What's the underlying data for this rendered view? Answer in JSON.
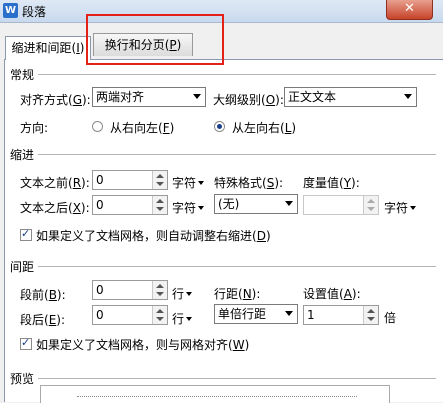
{
  "window": {
    "title": "段落",
    "icon_glyph": "W",
    "close_glyph": "✕"
  },
  "tabs": [
    {
      "label": "缩进和间距(",
      "key": "I",
      "end": ")"
    },
    {
      "label": "换行和分页(",
      "key": "P",
      "end": ")"
    }
  ],
  "general": {
    "heading": "常规",
    "align_label": "对齐方式(",
    "align_key": "G",
    "align_end": "):",
    "align_value": "两端对齐",
    "outline_label": "大纲级别(",
    "outline_key": "O",
    "outline_end": "):",
    "outline_value": "正文文本",
    "direction_label": "方向:",
    "rtl_label": "从右向左(",
    "rtl_key": "F",
    "rtl_end": ")",
    "ltr_label": "从左向右(",
    "ltr_key": "L",
    "ltr_end": ")"
  },
  "indent": {
    "heading": "缩进",
    "before_label": "文本之前(",
    "before_key": "R",
    "before_end": "):",
    "before_value": "0",
    "after_label": "文本之后(",
    "after_key": "X",
    "after_end": "):",
    "after_value": "0",
    "unit": "字符",
    "special_label": "特殊格式(",
    "special_key": "S",
    "special_end": "):",
    "special_value": "(无)",
    "measure_label": "度量值(",
    "measure_key": "Y",
    "measure_end": "):",
    "measure_value": "",
    "grid_check": "如果定义了文档网格，则自动调整右缩进(",
    "grid_key": "D",
    "grid_end": ")"
  },
  "spacing": {
    "heading": "间距",
    "before_label": "段前(",
    "before_key": "B",
    "before_end": "):",
    "before_value": "0",
    "after_label": "段后(",
    "after_key": "E",
    "after_end": "):",
    "after_value": "0",
    "unit": "行",
    "line_label": "行距(",
    "line_key": "N",
    "line_end": "):",
    "line_value": "单倍行距",
    "set_label": "设置值(",
    "set_key": "A",
    "set_end": "):",
    "set_value": "1",
    "set_unit": "倍",
    "grid_check": "如果定义了文档网格，则与网格对齐(",
    "grid_key": "W",
    "grid_end": ")"
  },
  "preview": {
    "heading": "预览"
  }
}
